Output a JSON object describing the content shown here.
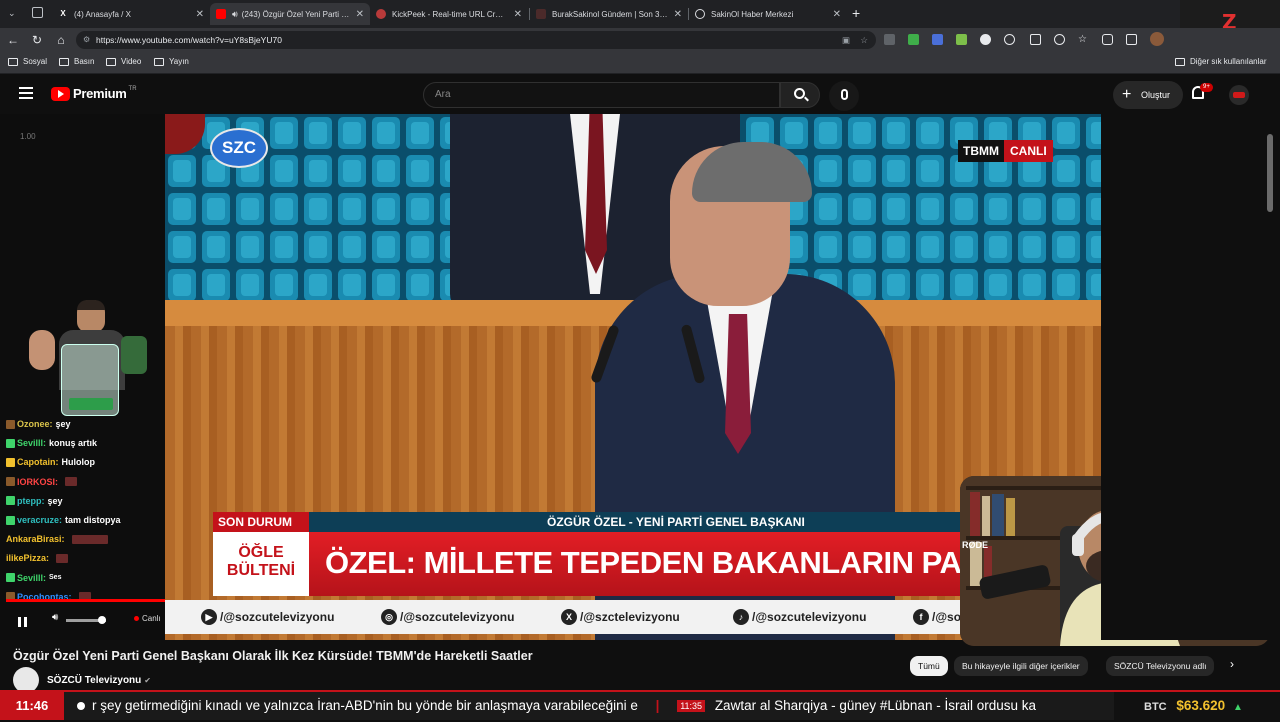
{
  "browser": {
    "tabs": [
      {
        "title": "(4) Anasayfa / X",
        "icon": "x-logo-icon",
        "active": false
      },
      {
        "title": "(243) Özgür Özel Yeni Parti Ge",
        "icon": "youtube-icon",
        "active": true
      },
      {
        "title": "KickPeek - Real-time URL Crawler",
        "icon": "kickpeek-icon",
        "active": false
      },
      {
        "title": "BurakSakinol Gündem | Son 3 Gün",
        "icon": "burak-icon",
        "active": false
      },
      {
        "title": "SakinOl Haber Merkezi",
        "icon": "globe-icon",
        "active": false
      }
    ],
    "url": "https://www.youtube.com/watch?v=uY8sBjeYU70",
    "bookmarks": [
      "Sosyal",
      "Basın",
      "Video",
      "Yayın"
    ],
    "bookmarks_right": "Diğer sık kullanılanlar"
  },
  "youtube": {
    "logo_text": "Premium",
    "logo_region": "TR",
    "search_placeholder": "Ara",
    "create_label": "Oluştur",
    "notifications_badge": "9+"
  },
  "overlay": {
    "chat_time": "1.00",
    "chat": [
      {
        "user": "Ozonee:",
        "msg": "şey",
        "color": "#d8c24a",
        "badge": "#8a5a2b"
      },
      {
        "user": "Sevilll:",
        "msg": "konuş artık",
        "color": "#3fd46b",
        "badge": "#3fd46b"
      },
      {
        "user": "Capotain:",
        "msg": "Hulolop",
        "color": "#f2c12e",
        "badge": "#f2c12e"
      },
      {
        "user": "IORKOSI:",
        "msg": "",
        "color": "#ff4444",
        "badge": "#8a5a2b"
      },
      {
        "user": "ptepp:",
        "msg": "şey",
        "color": "#2fbfbf",
        "badge": "#3fd46b"
      },
      {
        "user": "veracruze:",
        "msg": "tam distopya",
        "color": "#2fbfbf",
        "badge": "#3fd46b"
      },
      {
        "user": "AnkaraBirasi:",
        "msg": "",
        "color": "#f2c12e",
        "badge": ""
      },
      {
        "user": "ilikePizza:",
        "msg": "",
        "color": "#f2c12e",
        "badge": ""
      },
      {
        "user": "Sevilll:",
        "msg": "Ses",
        "color": "#3fd46b",
        "badge": "#3fd46b"
      },
      {
        "user": "Pocohontas:",
        "msg": "",
        "color": "#2f8fff",
        "badge": "#8a5a2b"
      }
    ],
    "live_label": "Canlı"
  },
  "broadcast": {
    "channel_logo": "SZC",
    "top_right_tag": "TBMM",
    "top_right_live": "CANLI",
    "son_durum": "SON DURUM",
    "headline_sub": "ÖZGÜR ÖZEL - YENİ PARTİ GENEL BAŞKANI",
    "program_line1": "ÖĞLE",
    "program_line2": "BÜLTENİ",
    "headline_main": "ÖZEL: MİLLETE TEPEDEN BAKANLARIN PARTİSİ D",
    "socials": [
      "/@sozcutelevizyonu",
      "/@sozcutelevizyonu",
      "/@szctelevizyonu",
      "/@sozcutelevizyonu",
      "/@so"
    ],
    "webcam_banner": "RØDE"
  },
  "video": {
    "title": "Özgür Özel Yeni Parti Genel Başkanı Olarak İlk Kez Kürsüde! TBMM'de Hareketli Saatler",
    "channel": "SÖZCÜ Televizyonu",
    "chips": [
      "Tümü",
      "Bu hikayeyle ilgili diğer içerikler",
      "SÖZCÜ Televizyonu adlı"
    ]
  },
  "ticker": {
    "clock": "11:46",
    "text_a": "r şey getirmediğini kınadı ve yalnızca İran-ABD'nin bu yönde bir anlaşmaya varabileceğini e",
    "time_b": "11:35",
    "text_b": "Zawtar al Sharqiya - güney #Lübnan - İsrail ordusu ka",
    "btc_label": "BTC",
    "btc_value": "$63.620"
  }
}
